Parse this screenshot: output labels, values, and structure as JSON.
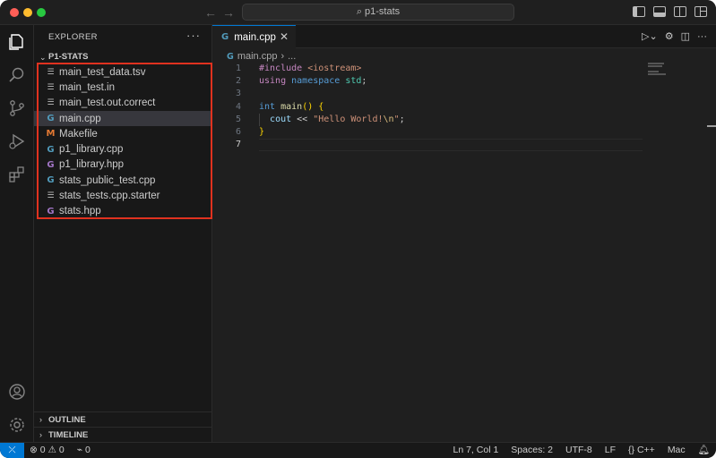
{
  "window": {
    "search_label": "p1-stats"
  },
  "sidebar": {
    "title": "EXPLORER",
    "more": "···",
    "folder": "P1-STATS",
    "files": [
      {
        "name": "main_test_data.tsv",
        "icon": "lines-file-icon"
      },
      {
        "name": "main_test.in",
        "icon": "lines-file-icon"
      },
      {
        "name": "main_test.out.correct",
        "icon": "lines-file-icon"
      },
      {
        "name": "main.cpp",
        "icon": "cpp-file-icon",
        "active": true
      },
      {
        "name": "Makefile",
        "icon": "makefile-icon"
      },
      {
        "name": "p1_library.cpp",
        "icon": "cpp-file-icon"
      },
      {
        "name": "p1_library.hpp",
        "icon": "hpp-file-icon"
      },
      {
        "name": "stats_public_test.cpp",
        "icon": "cpp-file-icon"
      },
      {
        "name": "stats_tests.cpp.starter",
        "icon": "lines-file-icon"
      },
      {
        "name": "stats.hpp",
        "icon": "hpp-file-icon"
      }
    ],
    "outline_label": "OUTLINE",
    "timeline_label": "TIMELINE"
  },
  "editor": {
    "tab_label": "main.cpp",
    "breadcrumb_file": "main.cpp",
    "breadcrumb_rest": "...",
    "lines": [
      "1",
      "2",
      "3",
      "4",
      "5",
      "6",
      "7"
    ]
  },
  "statusbar": {
    "errors": "0",
    "warnings": "0",
    "ports": "0",
    "position": "Ln 7, Col 1",
    "spaces": "Spaces: 2",
    "encoding": "UTF-8",
    "eol": "LF",
    "language": "C++",
    "platform": "Mac"
  },
  "colors": {
    "accent": "#0078d4",
    "highlight_border": "#e0321f"
  }
}
